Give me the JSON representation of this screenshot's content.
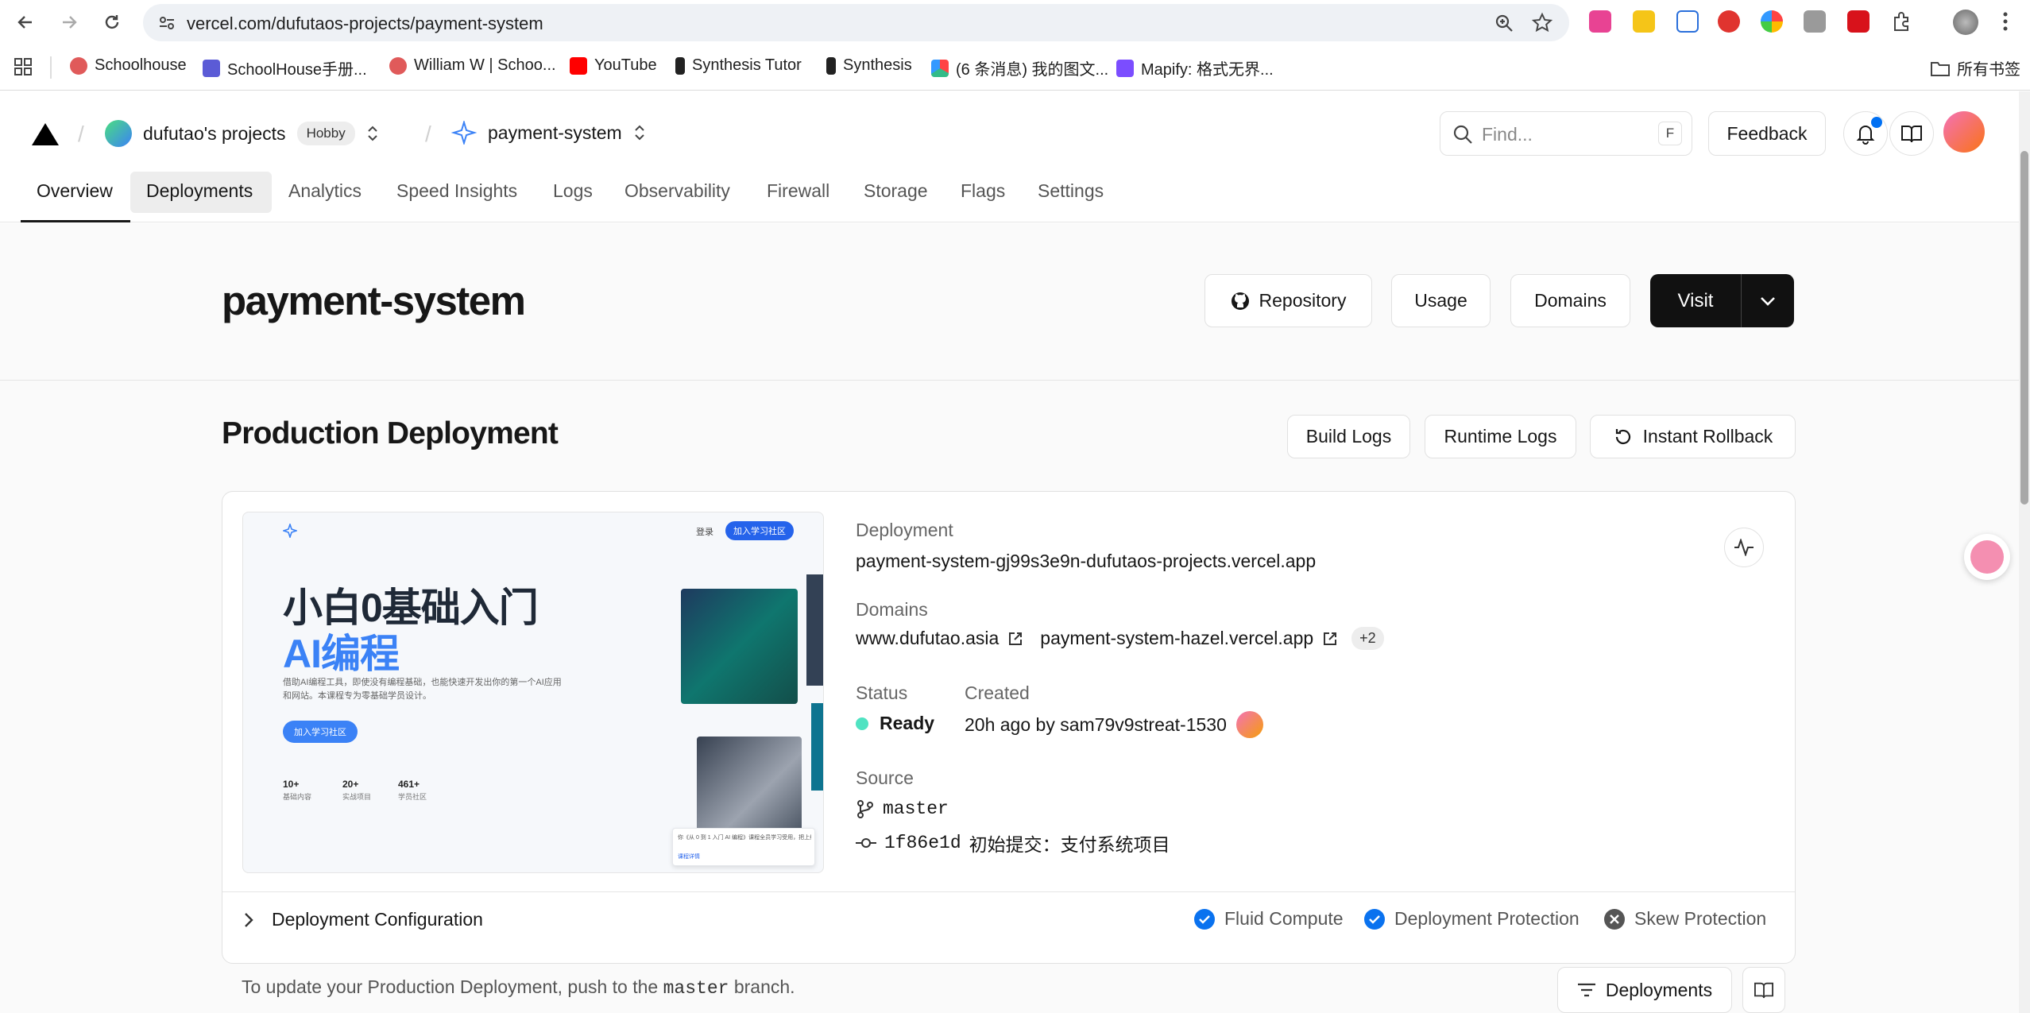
{
  "browser": {
    "url": "vercel.com/dufutaos-projects/payment-system",
    "bookmarks": [
      "Schoolhouse",
      "SchoolHouse手册...",
      "William W | Schoo...",
      "YouTube",
      "Synthesis Tutor",
      "Synthesis",
      "(6 条消息) 我的图文...",
      "Mapify: 格式无界..."
    ],
    "all_bookmarks": "所有书签"
  },
  "header": {
    "team": "dufutao's projects",
    "plan": "Hobby",
    "project": "payment-system",
    "search_placeholder": "Find...",
    "search_key": "F",
    "feedback": "Feedback"
  },
  "tabs": [
    "Overview",
    "Deployments",
    "Analytics",
    "Speed Insights",
    "Logs",
    "Observability",
    "Firewall",
    "Storage",
    "Flags",
    "Settings"
  ],
  "page": {
    "title": "payment-system",
    "repository": "Repository",
    "usage": "Usage",
    "domains": "Domains",
    "visit": "Visit"
  },
  "production": {
    "title": "Production Deployment",
    "build_logs": "Build Logs",
    "runtime_logs": "Runtime Logs",
    "instant_rollback": "Instant Rollback",
    "deployment_label": "Deployment",
    "deployment_url": "payment-system-gj99s3e9n-dufutaos-projects.vercel.app",
    "domains_label": "Domains",
    "domain1": "www.dufutao.asia",
    "domain2": "payment-system-hazel.vercel.app",
    "domain_more": "+2",
    "status_label": "Status",
    "status": "Ready",
    "created_label": "Created",
    "created": "20h ago by sam79v9streat-1530",
    "source_label": "Source",
    "branch": "master",
    "commit_hash": "1f86e1d",
    "commit_msg": "初始提交：支付系统项目",
    "config": "Deployment Configuration",
    "feat1": "Fluid Compute",
    "feat2": "Deployment Protection",
    "feat3": "Skew Protection",
    "footer_pre": "To update your Production Deployment, push to the ",
    "footer_branch": "master",
    "footer_post": " branch.",
    "deployments_btn": "Deployments"
  },
  "preview": {
    "nav_login": "登录",
    "nav_join": "加入学习社区",
    "hero1": "小白0基础入门",
    "hero2": "AI编程",
    "desc1": "借助AI编程工具，即使没有编程基础，也能快速开发出你的第一个AI应用",
    "desc2": "和网站。本课程专为零基础学员设计。",
    "cta": "加入学习社区",
    "stat1_n": "10+",
    "stat1_l": "基础内容",
    "stat2_n": "20+",
    "stat2_l": "实战项目",
    "stat3_n": "461+",
    "stat3_l": "学员社区",
    "toast1": "你《从 0 到 1 入门 AI 编程》课程全员学习受用，把上线",
    "toast2": "课程详情",
    "toast_link": "课程详情"
  },
  "colors": {
    "accent": "#0070f3",
    "ready": "#50e3c2",
    "check": "#0a72ef"
  }
}
